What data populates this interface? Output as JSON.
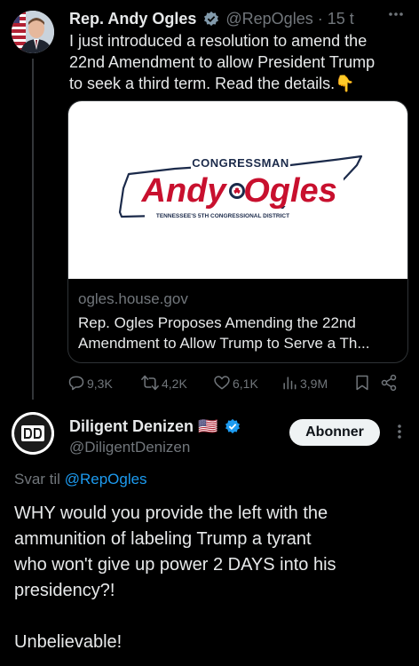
{
  "tweet1": {
    "name": "Rep. Andy Ogles",
    "handle": "@RepOgles",
    "time": "· 15 t",
    "text": "I just introduced a resolution to amend the\n22nd Amendment to allow President Trump\nto seek a third term. Read the details.👇",
    "card": {
      "logo_top": "CONGRESSMAN",
      "logo_main_1": "Andy",
      "logo_main_2": "Ogles",
      "logo_bottom": "TENNESSEE'S 5TH CONGRESSIONAL DISTRICT",
      "domain": "ogles.house.gov",
      "title": "Rep. Ogles Proposes Amending the 22nd\nAmendment to Allow Trump to Serve a Th..."
    },
    "actions": {
      "replies": "9,3K",
      "reposts": "4,2K",
      "likes": "6,1K",
      "views": "3,9M"
    }
  },
  "tweet2": {
    "name": "Diligent Denizen 🇺🇸",
    "handle": "@DiligentDenizen",
    "follow_label": "Abonner",
    "reply_prefix": "Svar til",
    "reply_mention": "@RepOgles",
    "text": "WHY would you provide the left with the\nammunition of labeling Trump a tyrant\nwho won't give up power 2 DAYS into his\npresidency?!\n\nUnbelievable!"
  },
  "colors": {
    "background": "#000000",
    "text": "#e7e9ea",
    "muted": "#71767b",
    "accent": "#1d9bf0",
    "logo_red": "#c8102e",
    "logo_navy": "#1b2a4a"
  }
}
